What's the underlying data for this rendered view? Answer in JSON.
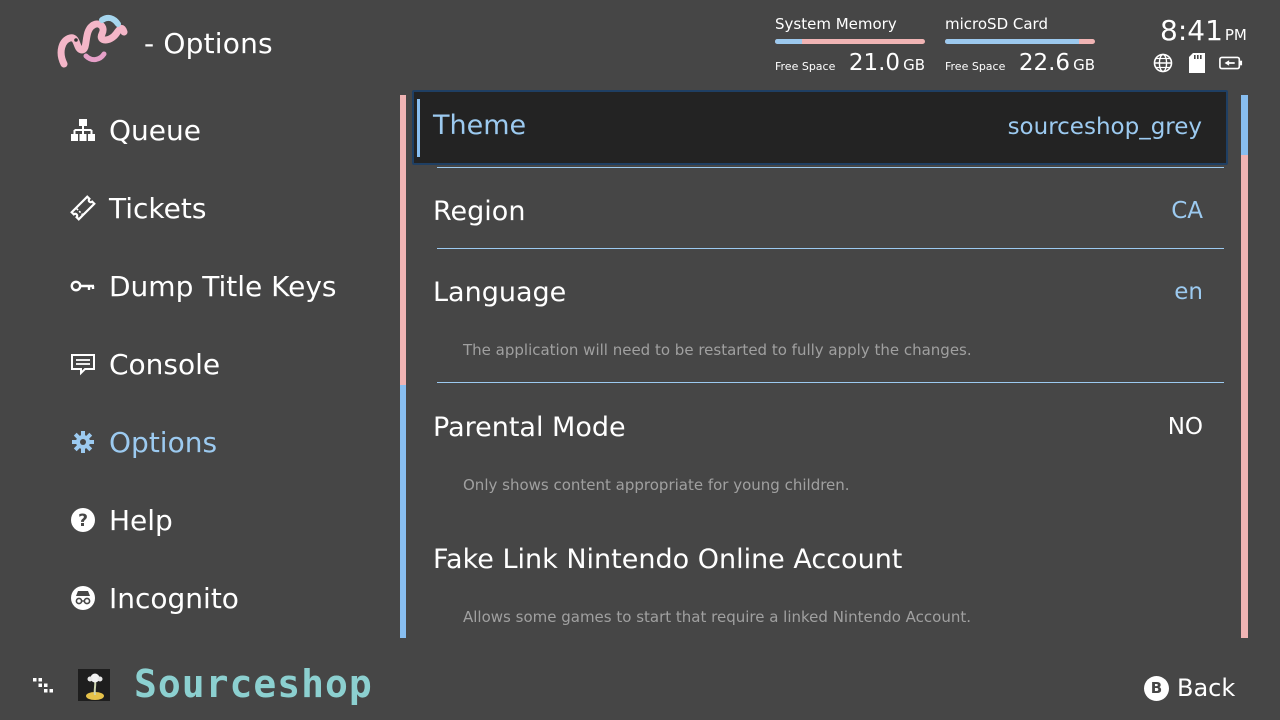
{
  "header": {
    "title": "- Options",
    "logo_icon": "worm-logo-icon"
  },
  "storage": {
    "system": {
      "label": "System Memory",
      "free_label": "Free Space",
      "amount": "21.0",
      "unit": "GB",
      "bar_used_fraction": 0.18
    },
    "sd": {
      "label": "microSD Card",
      "free_label": "Free Space",
      "amount": "22.6",
      "unit": "GB",
      "bar_used_fraction": 0.89
    }
  },
  "clock": {
    "time": "8:41",
    "ampm": "PM"
  },
  "status_icons": [
    "globe-icon",
    "sd-card-icon",
    "battery-icon"
  ],
  "sidebar": {
    "items": [
      {
        "label": "Queue",
        "icon": "hierarchy-icon"
      },
      {
        "label": "Tickets",
        "icon": "ticket-icon"
      },
      {
        "label": "Dump Title Keys",
        "icon": "key-icon"
      },
      {
        "label": "Console",
        "icon": "console-icon"
      },
      {
        "label": "Options",
        "icon": "gear-icon",
        "active": true
      },
      {
        "label": "Help",
        "icon": "help-icon"
      },
      {
        "label": "Incognito",
        "icon": "incognito-icon"
      }
    ]
  },
  "settings": {
    "theme": {
      "name": "Theme",
      "value": "sourceshop_grey"
    },
    "region": {
      "name": "Region",
      "value": "CA"
    },
    "language": {
      "name": "Language",
      "value": "en",
      "description": "The application will need to be restarted to fully apply the changes."
    },
    "parental": {
      "name": "Parental Mode",
      "value": "NO",
      "description": "Only shows content appropriate for young children."
    },
    "fake_link": {
      "name": "Fake Link Nintendo Online Account",
      "description": "Allows some games to start that require a linked Nintendo Account."
    }
  },
  "footer": {
    "brand": "Sourceshop",
    "back_button": "B",
    "back_label": "Back"
  },
  "colors": {
    "background": "#464646",
    "accent_blue": "#9ccaf0",
    "accent_pink": "#f0b4b4",
    "brand_teal": "#8cd0d0",
    "highlight_bg": "#232323"
  }
}
